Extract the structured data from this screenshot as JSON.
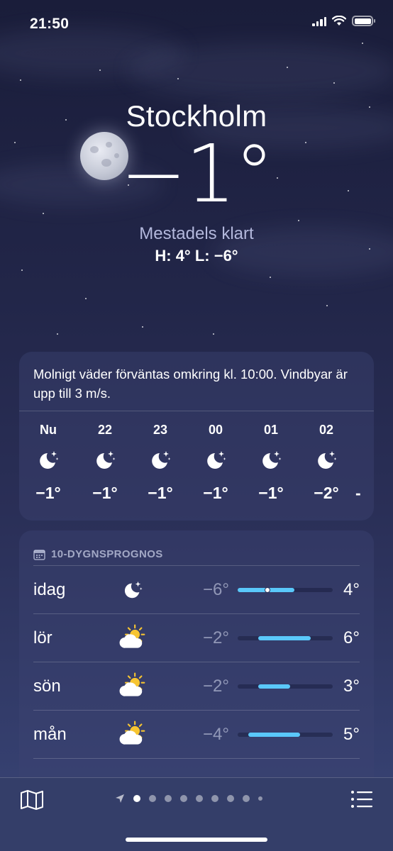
{
  "status_bar": {
    "time": "21:50"
  },
  "location": {
    "city": "Stockholm",
    "temperature": "−1°",
    "condition": "Mestadels klart",
    "high_low": "H: 4°  L: −6°"
  },
  "hourly": {
    "summary": "Molnigt väder förväntas omkring kl. 10:00. Vindbyar är upp till 3 m/s.",
    "items": [
      {
        "label": "Nu",
        "icon": "moon-stars-icon",
        "temp": "−1°"
      },
      {
        "label": "22",
        "icon": "moon-stars-icon",
        "temp": "−1°"
      },
      {
        "label": "23",
        "icon": "moon-stars-icon",
        "temp": "−1°"
      },
      {
        "label": "00",
        "icon": "moon-stars-icon",
        "temp": "−1°"
      },
      {
        "label": "01",
        "icon": "moon-stars-icon",
        "temp": "−1°"
      },
      {
        "label": "02",
        "icon": "moon-stars-icon",
        "temp": "−2°"
      }
    ]
  },
  "daily": {
    "header": "10-DYGNSPROGNOS",
    "days": [
      {
        "name": "idag",
        "icon": "moon-stars-icon",
        "low": "−6°",
        "high": "4°",
        "bar_start": 0.0,
        "bar_end": 0.6,
        "current": 0.31
      },
      {
        "name": "lör",
        "icon": "sun-cloud-icon",
        "low": "−2°",
        "high": "6°",
        "bar_start": 0.22,
        "bar_end": 0.77
      },
      {
        "name": "sön",
        "icon": "sun-cloud-icon",
        "low": "−2°",
        "high": "3°",
        "bar_start": 0.22,
        "bar_end": 0.55
      },
      {
        "name": "mån",
        "icon": "sun-cloud-icon",
        "low": "−4°",
        "high": "5°",
        "bar_start": 0.11,
        "bar_end": 0.66
      }
    ]
  },
  "colors": {
    "bar_fill": "#5ac8fa",
    "background_top": "#1a1d3a",
    "background_bottom": "#394577"
  },
  "pager": {
    "pages": 9,
    "active_index": 0
  }
}
